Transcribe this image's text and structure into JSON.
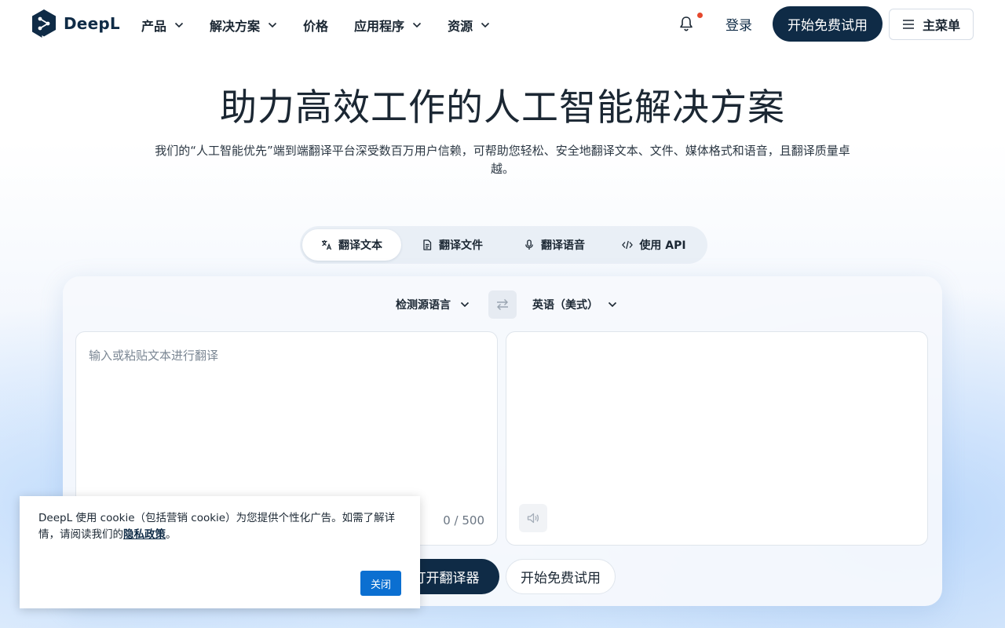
{
  "header": {
    "logo_text": "DeepL",
    "nav": [
      {
        "label": "产品",
        "has_dropdown": true
      },
      {
        "label": "解决方案",
        "has_dropdown": true
      },
      {
        "label": "价格",
        "has_dropdown": false
      },
      {
        "label": "应用程序",
        "has_dropdown": true
      },
      {
        "label": "资源",
        "has_dropdown": true
      }
    ],
    "login_label": "登录",
    "cta_label": "开始免费试用",
    "menu_label": "主菜单"
  },
  "hero": {
    "title": "助力高效工作的人工智能解决方案",
    "subtitle": "我们的“人工智能优先”端到端翻译平台深受数百万用户信赖，可帮助您轻松、安全地翻译文本、文件、媒体格式和语音，且翻译质量卓越。"
  },
  "tabs": [
    {
      "label": "翻译文本",
      "icon": "translate-icon",
      "active": true
    },
    {
      "label": "翻译文件",
      "icon": "document-icon",
      "active": false
    },
    {
      "label": "翻译语音",
      "icon": "microphone-icon",
      "active": false
    },
    {
      "label": "使用 API",
      "icon": "code-icon",
      "active": false
    }
  ],
  "translator": {
    "source_language": "检测源语言",
    "target_language": "英语（美式）",
    "source_placeholder": "输入或粘贴文本进行翻译",
    "char_count": "0 / 500",
    "open_translator_label": "打开翻译器",
    "free_trial_label": "开始免费试用"
  },
  "cookie_banner": {
    "text_before": "DeepL 使用 cookie（包括营销 cookie）为您提供个性化广告。如需了解详情，请阅读我们的",
    "link_text": "隐私政策",
    "text_after": "。",
    "close_label": "关闭"
  },
  "colors": {
    "brand_navy": "#0f2b46",
    "notification_dot": "#e5482d",
    "cookie_button": "#0b6fd1"
  }
}
